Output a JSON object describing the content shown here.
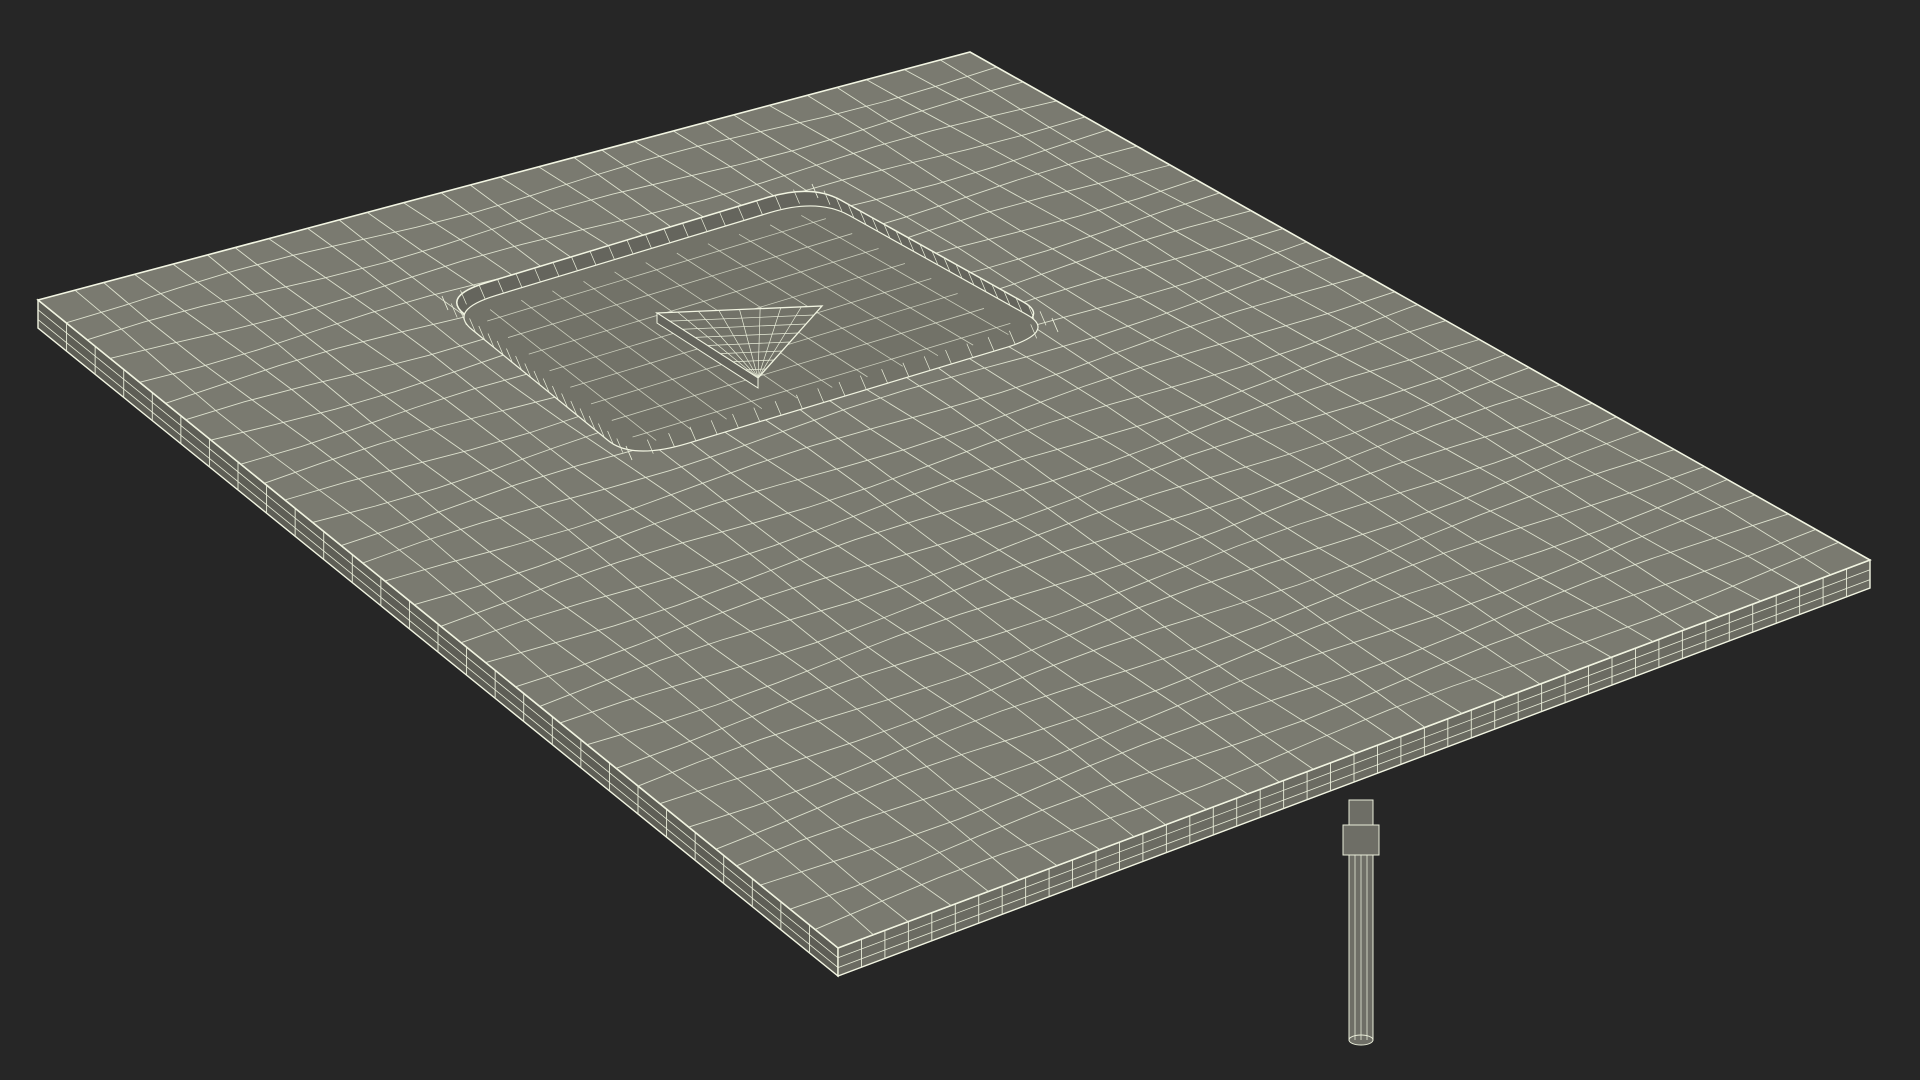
{
  "scene": {
    "subject": "wireframe-slab-with-recess",
    "colors": {
      "background": "#262626",
      "top_face": "#7a7a70",
      "front_face": "#6b6b62",
      "side_face": "#5e5e56",
      "recess_floor": "#727268",
      "recess_wall": "#65655d",
      "wire": "#e8ecd8",
      "edge_highlight": "#f2f5e2",
      "post": "#6e6e66"
    },
    "mesh": {
      "grid_u": 28,
      "grid_v": 32,
      "front_rim_segments": 44,
      "side_rim_segments": 28
    }
  }
}
